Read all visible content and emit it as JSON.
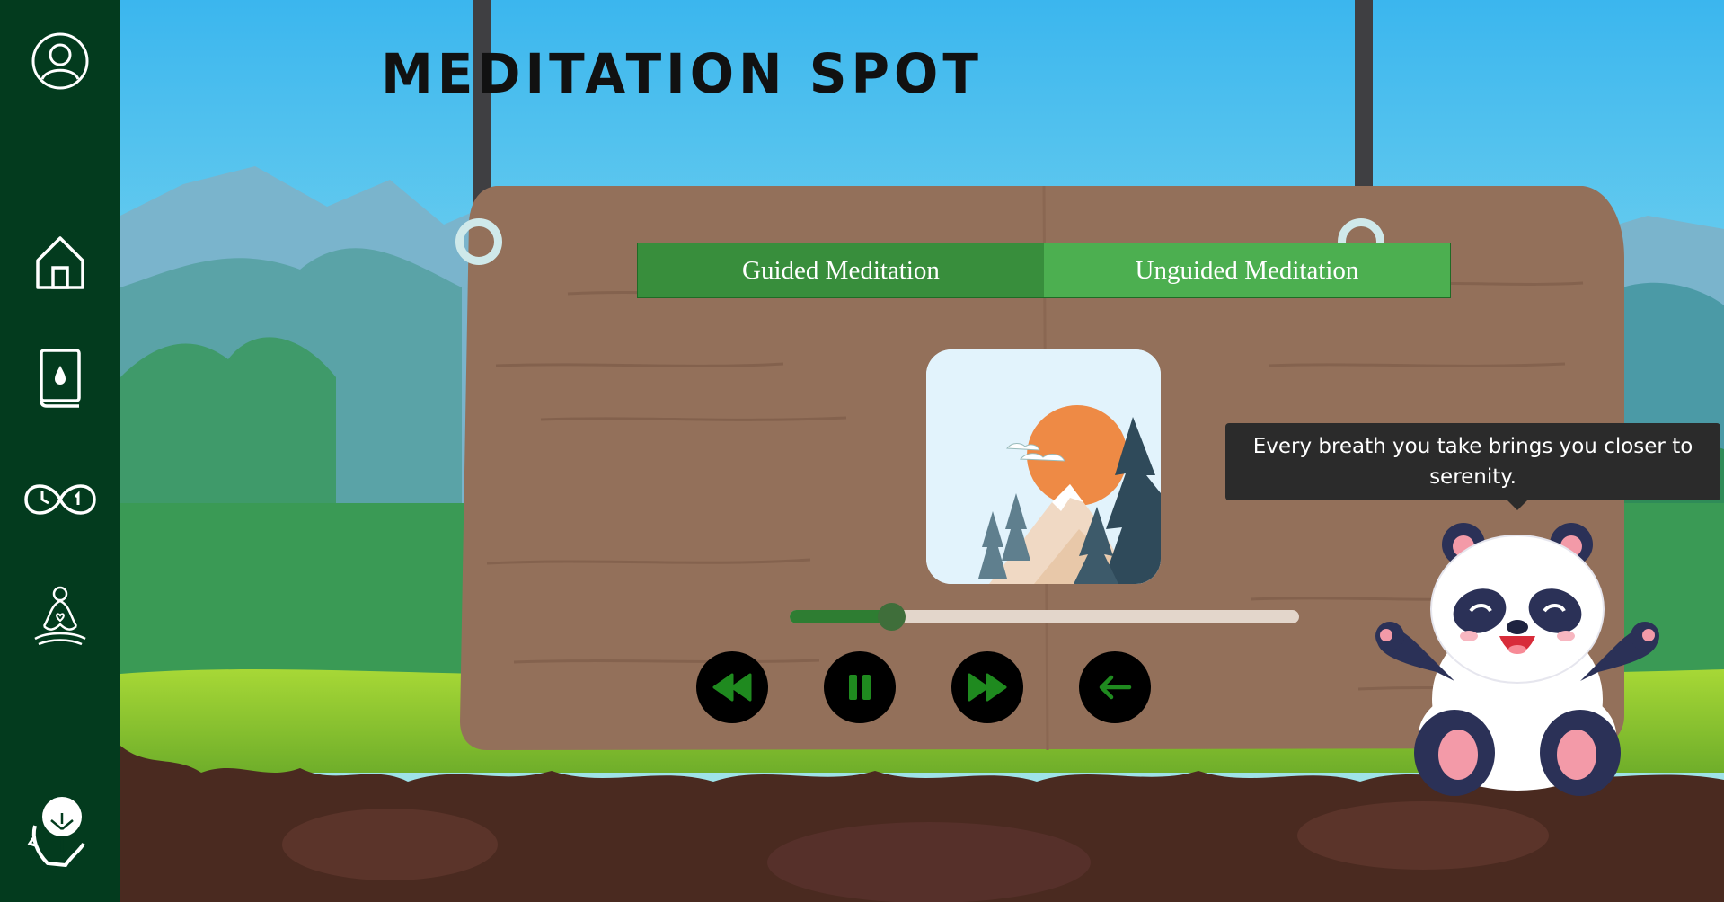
{
  "page": {
    "title": "MEDITATION SPOT"
  },
  "sidebar": {
    "items": [
      {
        "name": "profile",
        "icon": "user-circle-icon"
      },
      {
        "name": "home",
        "icon": "home-icon"
      },
      {
        "name": "journal",
        "icon": "book-drop-icon"
      },
      {
        "name": "timer",
        "icon": "infinity-clock-icon"
      },
      {
        "name": "meditation",
        "icon": "meditation-pose-icon"
      },
      {
        "name": "logo",
        "icon": "tree-head-logo-icon"
      }
    ]
  },
  "tabs": [
    {
      "label": "Guided Meditation",
      "active": true
    },
    {
      "label": "Unguided Meditation",
      "active": false
    }
  ],
  "player": {
    "artwork": "mountain-sunset-artwork",
    "progress_fraction": 0.2,
    "controls": [
      {
        "name": "rewind",
        "icon": "rewind-icon"
      },
      {
        "name": "pause",
        "icon": "pause-icon"
      },
      {
        "name": "fast-forward",
        "icon": "fast-forward-icon"
      },
      {
        "name": "back",
        "icon": "arrow-left-icon"
      }
    ]
  },
  "mascot": {
    "tooltip": "Every breath you take brings you closer to serenity.",
    "character": "panda-icon"
  },
  "colors": {
    "sidebar": "#033b1e",
    "tab_active": "#388e3c",
    "tab_inactive": "#4caf50",
    "progress": "#2e7d32",
    "control_icon": "#1f8a1f",
    "board": "#93705a"
  }
}
